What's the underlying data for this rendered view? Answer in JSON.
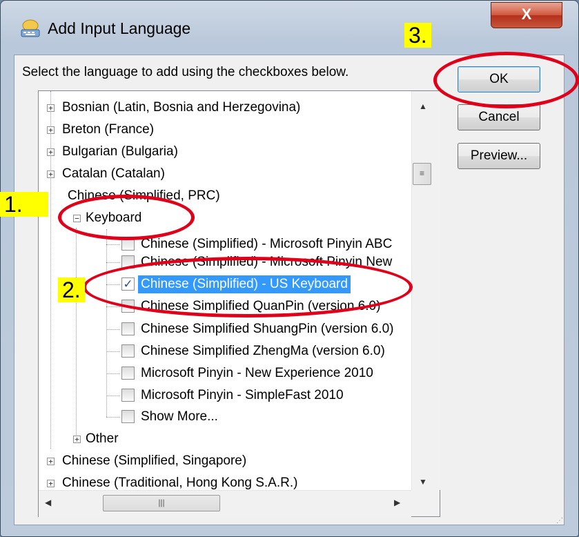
{
  "window": {
    "title": "Add Input Language",
    "close_glyph": "X"
  },
  "instruction": "Select the language to add using the checkboxes below.",
  "tree": {
    "languages_top": [
      "Bosnian (Latin, Bosnia and Herzegovina)",
      "Breton (France)",
      "Bulgarian (Bulgaria)",
      "Catalan (Catalan)"
    ],
    "expanded_language": "Chinese (Simplified, PRC)",
    "keyboard_node": "Keyboard",
    "keyboards": [
      {
        "label": "Chinese (Simplified) - Microsoft Pinyin ABC",
        "checked": false
      },
      {
        "label": "Chinese (Simplified) - Microsoft Pinyin New",
        "checked": false
      },
      {
        "label": "Chinese (Simplified) - US Keyboard",
        "checked": true
      },
      {
        "label": "Chinese Simplified QuanPin (version 6.0)",
        "checked": false
      },
      {
        "label": "Chinese Simplified ShuangPin (version 6.0)",
        "checked": false
      },
      {
        "label": "Chinese Simplified ZhengMa (version 6.0)",
        "checked": false
      },
      {
        "label": "Microsoft Pinyin - New Experience 2010",
        "checked": false
      },
      {
        "label": "Microsoft Pinyin - SimpleFast 2010",
        "checked": false
      },
      {
        "label": "Show More...",
        "checked": false
      }
    ],
    "other_node": "Other",
    "languages_bottom": [
      "Chinese (Simplified, Singapore)",
      "Chinese (Traditional, Hong Kong S.A.R.)"
    ]
  },
  "buttons": {
    "ok": "OK",
    "cancel": "Cancel",
    "preview": "Preview..."
  },
  "annotations": {
    "step1": "1.",
    "step2": "2.",
    "step3": "3.",
    "color": "#e0001a",
    "highlight": "#ffff00"
  },
  "colors": {
    "selection": "#3399ff"
  }
}
